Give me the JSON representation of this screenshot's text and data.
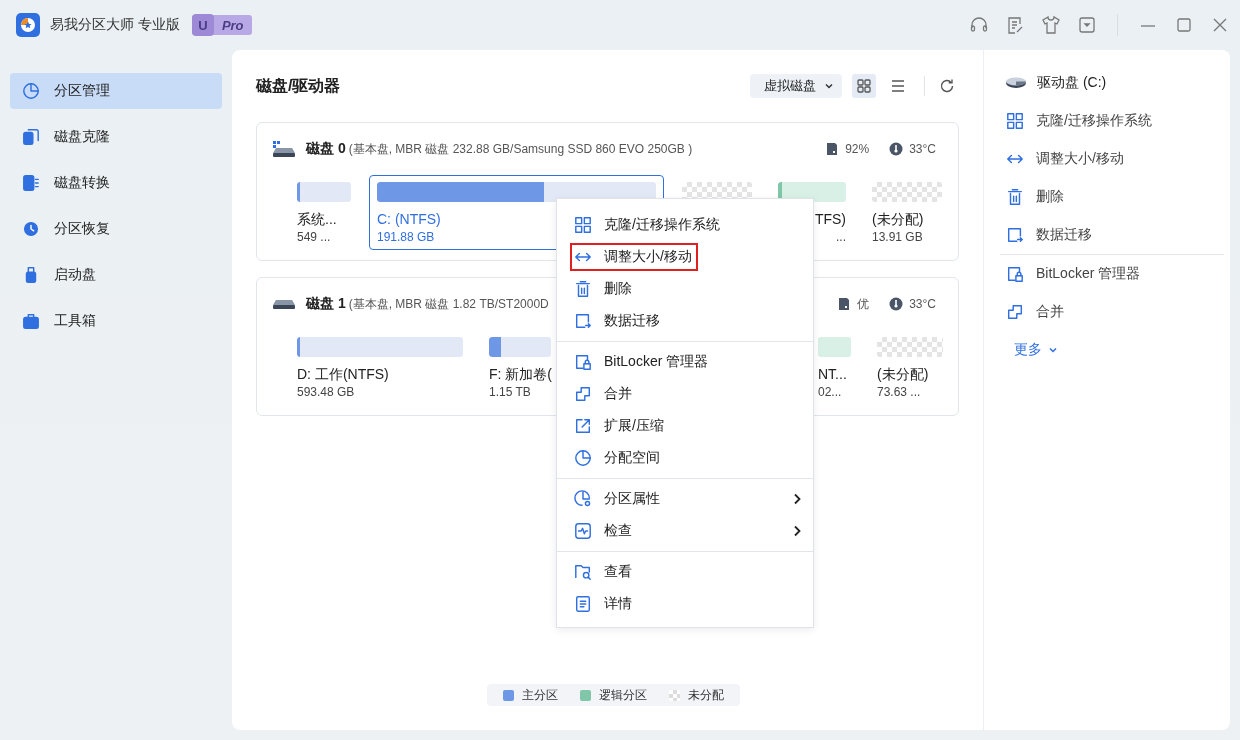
{
  "window": {
    "title": "易我分区大师 专业版",
    "badge_letter": "U",
    "badge_text": "Pro"
  },
  "sidebar": {
    "items": [
      {
        "label": "分区管理",
        "selected": true
      },
      {
        "label": "磁盘克隆",
        "selected": false
      },
      {
        "label": "磁盘转换",
        "selected": false
      },
      {
        "label": "分区恢复",
        "selected": false
      },
      {
        "label": "启动盘",
        "selected": false
      },
      {
        "label": "工具箱",
        "selected": false
      }
    ]
  },
  "main": {
    "title": "磁盘/驱动器",
    "view_dropdown": "虚拟磁盘",
    "grid_view": {
      "selected": true
    },
    "list_view": {
      "selected": false
    }
  },
  "disks": [
    {
      "name": "磁盘 0",
      "details": "(基本盘, MBR 磁盘 232.88 GB/Samsung SSD 860 EVO 250GB )",
      "health": "92%",
      "temperature": "33°C",
      "partitions": [
        {
          "kind": "primary",
          "label": "系统...",
          "size": "549 ...",
          "level": 0.06,
          "selected": false
        },
        {
          "kind": "primary",
          "label": "C: (NTFS)",
          "size": "191.88 GB",
          "level": 0.6,
          "selected": true
        },
        {
          "kind": "unallocated",
          "selected": false
        },
        {
          "kind": "logical",
          "label": "TFS)",
          "size": "...",
          "level": 0.06,
          "selected": false
        },
        {
          "kind": "unallocated",
          "label": "(未分配)",
          "size": "13.91 GB",
          "selected": false
        }
      ]
    },
    {
      "name": "磁盘 1",
      "details": "(基本盘, MBR 磁盘 1.82 TB/ST2000D",
      "health": "优",
      "temperature": "33°C",
      "partitions": [
        {
          "kind": "primary",
          "label": "D: 工作(NTFS)",
          "size": "593.48 GB",
          "level": 0.02,
          "selected": false
        },
        {
          "kind": "primary",
          "label": "F: 新加卷(",
          "size": "1.15 TB",
          "level": 0.2,
          "selected": false
        },
        {
          "kind": "logical",
          "label": "NT...",
          "size": "02...",
          "selected": false
        },
        {
          "kind": "unallocated",
          "label": "(未分配)",
          "size": "73.63 ...",
          "selected": false
        }
      ]
    }
  ],
  "context_menu": {
    "sections": [
      {
        "items": [
          {
            "label": "克隆/迁移操作系统",
            "kind": "action",
            "highlighted": false
          },
          {
            "label": "调整大小/移动",
            "kind": "action",
            "highlighted": true
          },
          {
            "label": "删除",
            "kind": "action",
            "highlighted": false
          },
          {
            "label": "数据迁移",
            "kind": "action",
            "highlighted": false
          }
        ]
      },
      {
        "items": [
          {
            "label": "BitLocker 管理器",
            "kind": "action",
            "highlighted": false
          },
          {
            "label": "合并",
            "kind": "action",
            "highlighted": false
          },
          {
            "label": "扩展/压缩",
            "kind": "action",
            "highlighted": false
          },
          {
            "label": "分配空间",
            "kind": "action",
            "highlighted": false
          }
        ]
      },
      {
        "items": [
          {
            "label": "分区属性",
            "kind": "submenu",
            "highlighted": false
          },
          {
            "label": "检查",
            "kind": "submenu",
            "highlighted": false
          }
        ]
      },
      {
        "items": [
          {
            "label": "查看",
            "kind": "action",
            "highlighted": false
          },
          {
            "label": "详情",
            "kind": "action",
            "highlighted": false
          }
        ]
      }
    ]
  },
  "right_panel": {
    "title": "驱动盘 (C:)",
    "groups": [
      {
        "items": [
          "克隆/迁移操作系统",
          "调整大小/移动",
          "删除",
          "数据迁移"
        ]
      },
      {
        "items": [
          "BitLocker 管理器",
          "合并"
        ]
      }
    ],
    "more": "更多"
  },
  "legend": [
    {
      "kind": "primary",
      "label": "主分区"
    },
    {
      "kind": "logical",
      "label": "逻辑分区"
    },
    {
      "kind": "unallocated",
      "label": "未分配"
    }
  ]
}
